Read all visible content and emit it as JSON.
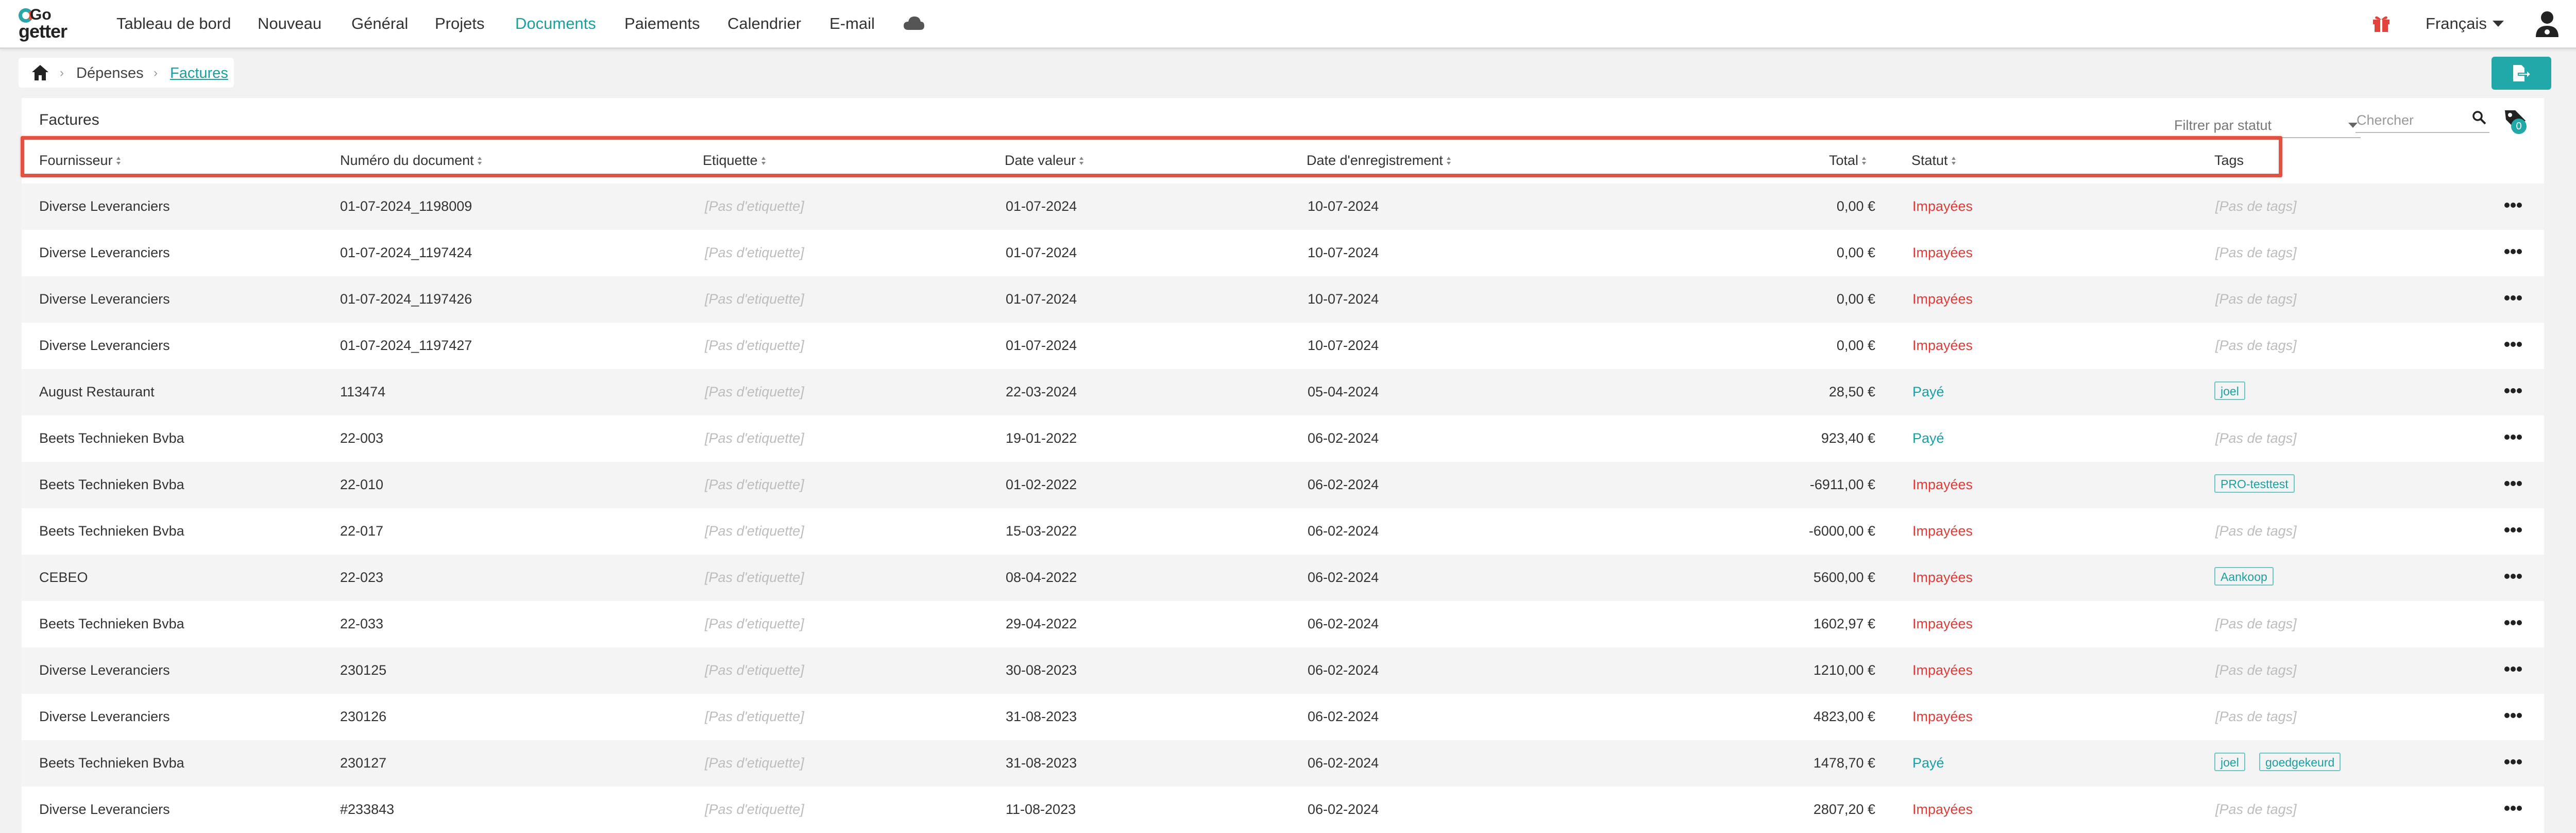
{
  "navbar": {
    "logo_top": "Go",
    "logo_bottom": "getter",
    "items": [
      {
        "label": "Tableau de bord"
      },
      {
        "label": "Nouveau"
      },
      {
        "label": "Général"
      },
      {
        "label": "Projets"
      },
      {
        "label": "Documents",
        "active": true
      },
      {
        "label": "Paiements"
      },
      {
        "label": "Calendrier"
      },
      {
        "label": "E-mail"
      }
    ],
    "language": "Français",
    "icons": [
      "cloud-icon",
      "gift-icon",
      "user-icon"
    ],
    "accent_color": "#1aa0a3"
  },
  "breadcrumb": {
    "items": [
      "Dépenses",
      "Factures"
    ]
  },
  "panel": {
    "title": "Factures",
    "filter_placeholder": "Filtrer par statut",
    "search_placeholder": "Chercher",
    "tags_count": "0"
  },
  "table": {
    "columns": [
      "Fournisseur",
      "Numéro du document",
      "Etiquette",
      "Date valeur",
      "Date d'enregistrement",
      "Total",
      "Statut",
      "Tags"
    ],
    "rows": [
      {
        "supplier": "Diverse Leveranciers",
        "doc": "01-07-2024_1198009",
        "label": "[Pas d'etiquette]",
        "date_value": "01-07-2024",
        "date_reg": "10-07-2024",
        "total": "0,00 €",
        "status": "Impayées",
        "tags_text": "[Pas de tags]",
        "tags": []
      },
      {
        "supplier": "Diverse Leveranciers",
        "doc": "01-07-2024_1197424",
        "label": "[Pas d'etiquette]",
        "date_value": "01-07-2024",
        "date_reg": "10-07-2024",
        "total": "0,00 €",
        "status": "Impayées",
        "tags_text": "[Pas de tags]",
        "tags": []
      },
      {
        "supplier": "Diverse Leveranciers",
        "doc": "01-07-2024_1197426",
        "label": "[Pas d'etiquette]",
        "date_value": "01-07-2024",
        "date_reg": "10-07-2024",
        "total": "0,00 €",
        "status": "Impayées",
        "tags_text": "[Pas de tags]",
        "tags": []
      },
      {
        "supplier": "Diverse Leveranciers",
        "doc": "01-07-2024_1197427",
        "label": "[Pas d'etiquette]",
        "date_value": "01-07-2024",
        "date_reg": "10-07-2024",
        "total": "0,00 €",
        "status": "Impayées",
        "tags_text": "[Pas de tags]",
        "tags": []
      },
      {
        "supplier": "August Restaurant",
        "doc": "113474",
        "label": "[Pas d'etiquette]",
        "date_value": "22-03-2024",
        "date_reg": "05-04-2024",
        "total": "28,50 €",
        "status": "Payé",
        "tags_text": "",
        "tags": [
          "joel"
        ]
      },
      {
        "supplier": "Beets Technieken Bvba",
        "doc": "22-003",
        "label": "[Pas d'etiquette]",
        "date_value": "19-01-2022",
        "date_reg": "06-02-2024",
        "total": "923,40 €",
        "status": "Payé",
        "tags_text": "[Pas de tags]",
        "tags": []
      },
      {
        "supplier": "Beets Technieken Bvba",
        "doc": "22-010",
        "label": "[Pas d'etiquette]",
        "date_value": "01-02-2022",
        "date_reg": "06-02-2024",
        "total": "-6911,00 €",
        "status": "Impayées",
        "tags_text": "",
        "tags": [
          "PRO-testtest"
        ]
      },
      {
        "supplier": "Beets Technieken Bvba",
        "doc": "22-017",
        "label": "[Pas d'etiquette]",
        "date_value": "15-03-2022",
        "date_reg": "06-02-2024",
        "total": "-6000,00 €",
        "status": "Impayées",
        "tags_text": "[Pas de tags]",
        "tags": []
      },
      {
        "supplier": "CEBEO",
        "doc": "22-023",
        "label": "[Pas d'etiquette]",
        "date_value": "08-04-2022",
        "date_reg": "06-02-2024",
        "total": "5600,00 €",
        "status": "Impayées",
        "tags_text": "",
        "tags": [
          "Aankoop"
        ]
      },
      {
        "supplier": "Beets Technieken Bvba",
        "doc": "22-033",
        "label": "[Pas d'etiquette]",
        "date_value": "29-04-2022",
        "date_reg": "06-02-2024",
        "total": "1602,97 €",
        "status": "Impayées",
        "tags_text": "[Pas de tags]",
        "tags": []
      },
      {
        "supplier": "Diverse Leveranciers",
        "doc": "230125",
        "label": "[Pas d'etiquette]",
        "date_value": "30-08-2023",
        "date_reg": "06-02-2024",
        "total": "1210,00 €",
        "status": "Impayées",
        "tags_text": "[Pas de tags]",
        "tags": []
      },
      {
        "supplier": "Diverse Leveranciers",
        "doc": "230126",
        "label": "[Pas d'etiquette]",
        "date_value": "31-08-2023",
        "date_reg": "06-02-2024",
        "total": "4823,00 €",
        "status": "Impayées",
        "tags_text": "[Pas de tags]",
        "tags": []
      },
      {
        "supplier": "Beets Technieken Bvba",
        "doc": "230127",
        "label": "[Pas d'etiquette]",
        "date_value": "31-08-2023",
        "date_reg": "06-02-2024",
        "total": "1478,70 €",
        "status": "Payé",
        "tags_text": "",
        "tags": [
          "joel",
          "goedgekeurd"
        ]
      },
      {
        "supplier": "Diverse Leveranciers",
        "doc": "#233843",
        "label": "[Pas d'etiquette]",
        "date_value": "11-08-2023",
        "date_reg": "06-02-2024",
        "total": "2807,20 €",
        "status": "Impayées",
        "tags_text": "[Pas de tags]",
        "tags": []
      }
    ]
  },
  "colors": {
    "accent": "#1aa0a3",
    "unpaid": "#e53935",
    "highlight": "#e15241"
  }
}
